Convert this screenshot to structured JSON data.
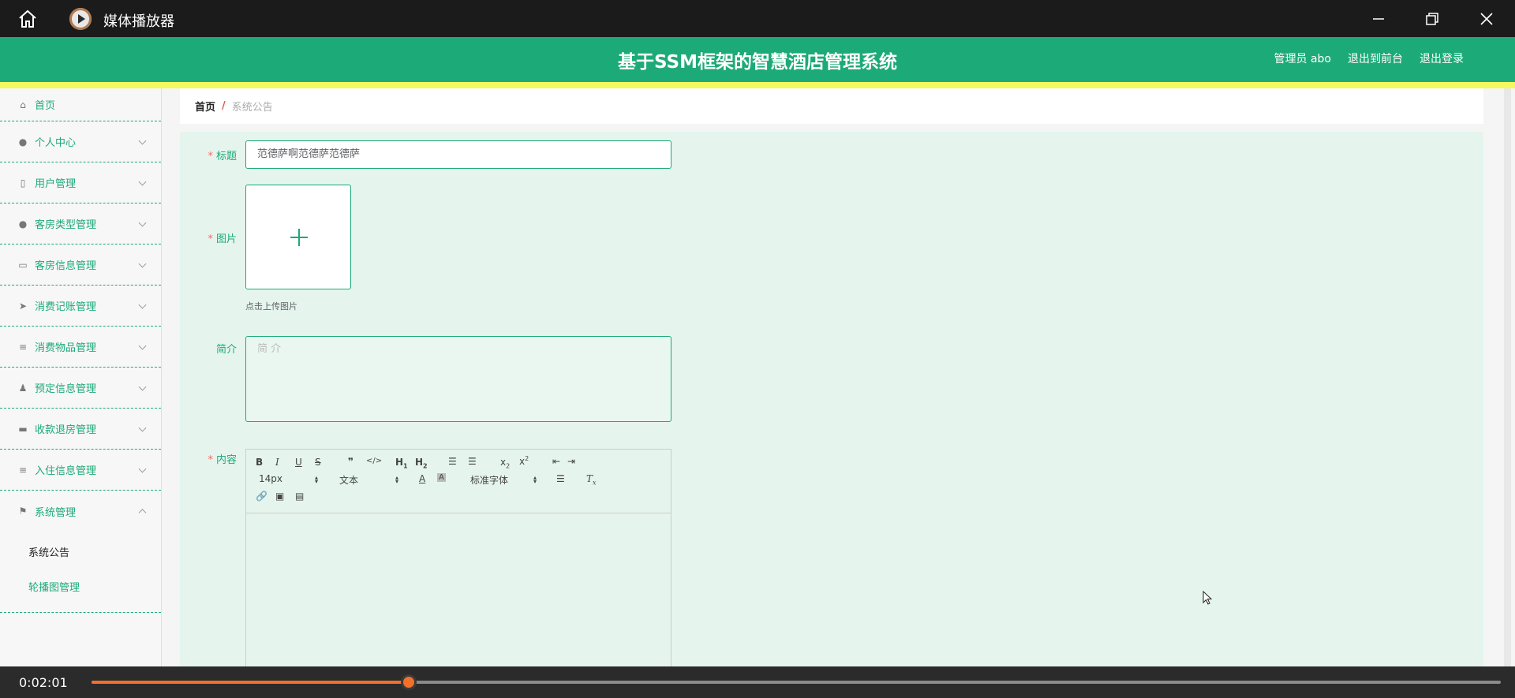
{
  "player": {
    "title": "媒体播放器",
    "time": "0:02:01",
    "progress_fraction": 0.2252
  },
  "header": {
    "system_title": "基于SSM框架的智慧酒店管理系统",
    "admin_label": "管理员 abo",
    "to_front": "退出到前台",
    "logout": "退出登录"
  },
  "sidebar": {
    "items": [
      {
        "label": "首页",
        "icon": "home-icon"
      },
      {
        "label": "个人中心",
        "icon": "user-icon"
      },
      {
        "label": "用户管理",
        "icon": "phone-icon"
      },
      {
        "label": "客房类型管理",
        "icon": "pin-icon"
      },
      {
        "label": "客房信息管理",
        "icon": "chat-icon"
      },
      {
        "label": "消费记账管理",
        "icon": "send-icon"
      },
      {
        "label": "消费物品管理",
        "icon": "list-icon"
      },
      {
        "label": "预定信息管理",
        "icon": "stamp-icon"
      },
      {
        "label": "收款退房管理",
        "icon": "ticket-icon"
      },
      {
        "label": "入住信息管理",
        "icon": "list-icon"
      },
      {
        "label": "系统管理",
        "icon": "flag-icon"
      }
    ],
    "sub_items": [
      {
        "label": "系统公告"
      },
      {
        "label": "轮播图管理"
      }
    ]
  },
  "breadcrumb": {
    "home": "首页",
    "sep": "/",
    "current": "系统公告"
  },
  "form": {
    "title_label": "标题",
    "title_value": "范德萨啊范德萨范德萨",
    "image_label": "图片",
    "upload_tip": "点击上传图片",
    "intro_label": "简介",
    "intro_placeholder": "简 介",
    "content_label": "内容",
    "required_mark": "*"
  },
  "editor": {
    "font_size": "14px",
    "header_select": "文本",
    "font_family": "标准字体"
  },
  "colors": {
    "accent": "#1caa78",
    "highlight": "#f4f95d",
    "progress": "#f2702a"
  }
}
